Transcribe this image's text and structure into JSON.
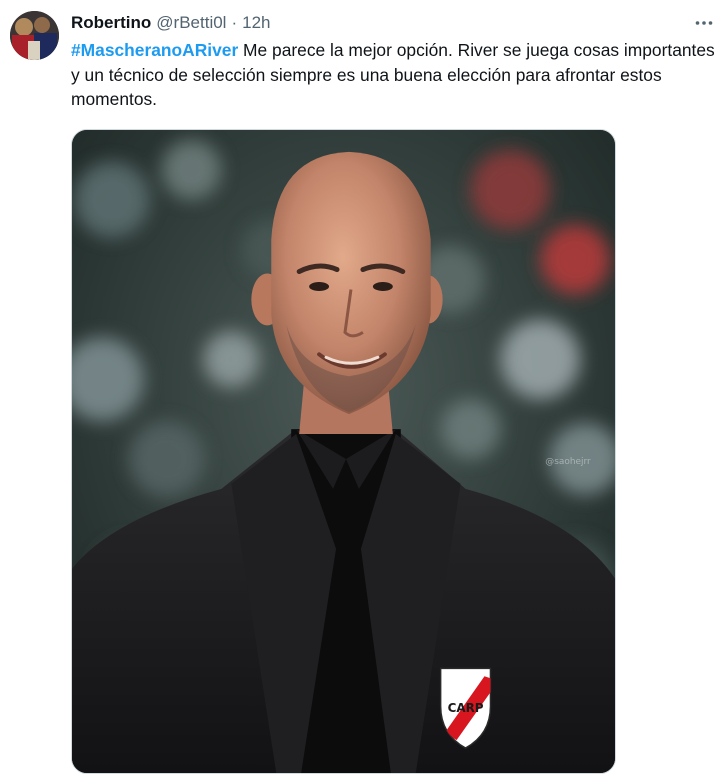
{
  "tweet": {
    "display_name": "Robertino",
    "handle": "@rBetti0l",
    "separator": "·",
    "time": "12h",
    "hashtag": "#MascheranoARiver",
    "body": " Me parece la mejor opción. River se juega cosas importantes y un técnico de selección siempre es una buena elección para afrontar estos momentos.",
    "media": {
      "alt": "Photo of a smiling coach in a black suit with a River Plate crest",
      "watermark": "@saohejrr",
      "crest_letters": "CARP"
    }
  },
  "icons": {
    "more": "more-horizontal-icon"
  },
  "colors": {
    "link": "#1d9bf0",
    "secondary_text": "#536471",
    "primary_text": "#0f1419",
    "crest_red": "#d7161f"
  }
}
